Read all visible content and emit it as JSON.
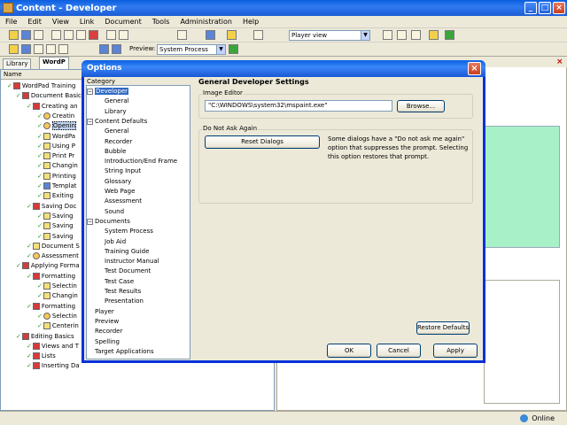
{
  "window": {
    "title": "Content - Developer"
  },
  "menu": [
    "File",
    "Edit",
    "View",
    "Link",
    "Document",
    "Tools",
    "Administration",
    "Help"
  ],
  "toolbar": {
    "view_combo": "Player view",
    "preview_label": "Preview:",
    "preview_combo": "System Process"
  },
  "left_tabs": [
    "Library",
    "WordP"
  ],
  "column_header": "Name",
  "tree": [
    "WordPad Training",
    "Document Basic",
    "Creating an",
    "Creatin",
    "Openin",
    "WordPa",
    "Using P",
    "Print Pr",
    "Changin",
    "Printing",
    "Templat",
    "Exiting",
    "Saving Doc",
    "Saving",
    "Saving",
    "Saving",
    "Document S",
    "Assessment",
    "Applying Forma",
    "Formatting",
    "Selectin",
    "Changin",
    "Formatting",
    "Selectin",
    "Centerin",
    "Editing Basics",
    "Views and T",
    "Lists",
    "Inserting Da"
  ],
  "dialog": {
    "title": "Options",
    "category_label": "Category",
    "categories": [
      "Developer",
      "General",
      "Library",
      "Content Defaults",
      "General",
      "Recorder",
      "Bubble",
      "Introduction/End Frame",
      "String Input",
      "Glossary",
      "Web Page",
      "Assessment",
      "Sound",
      "Documents",
      "System Process",
      "Job Aid",
      "Training Guide",
      "Instructor Manual",
      "Test Document",
      "Test Case",
      "Test Results",
      "Presentation",
      "Player",
      "Preview",
      "Recorder",
      "Spelling",
      "Target Applications"
    ],
    "panel_title": "General Developer Settings",
    "image_editor_label": "Image Editor",
    "image_editor_path": "\"C:\\WINDOWS\\system32\\mspaint.exe\"",
    "browse_label": "Browse...",
    "dnaa_label": "Do Not Ask Again",
    "reset_label": "Reset Dialogs",
    "reset_desc": "Some dialogs have a \"Do not ask me again\" option that suppresses the prompt. Selecting this option restores that prompt.",
    "restore_label": "Restore Defaults",
    "ok_label": "OK",
    "cancel_label": "Cancel",
    "apply_label": "Apply"
  },
  "status": {
    "online": "Online"
  }
}
